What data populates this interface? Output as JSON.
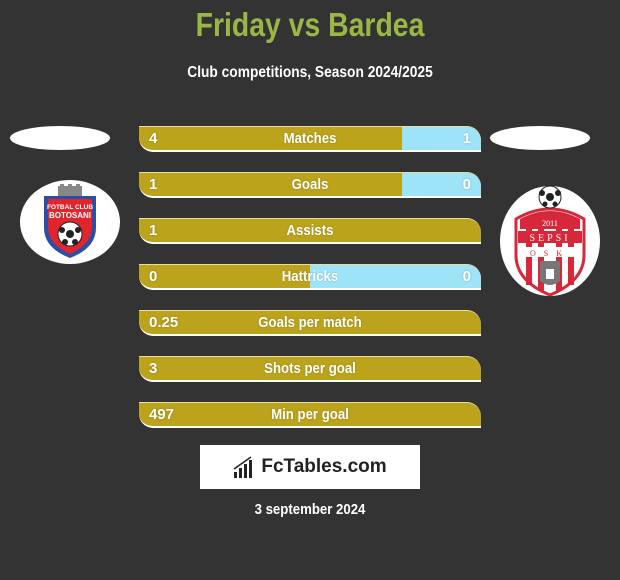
{
  "header": {
    "title": "Friday vs Bardea",
    "subtitle": "Club competitions, Season 2024/2025"
  },
  "teams": {
    "left": {
      "name": "Friday",
      "logo": "FC Botosani crest",
      "logo_text": [
        "FOTBAL CLUB",
        "BOTOSANI"
      ]
    },
    "right": {
      "name": "Bardea",
      "logo": "Sepsi OSK crest",
      "logo_text": [
        "2011",
        "SEPSI",
        "OSK"
      ]
    }
  },
  "colors": {
    "background": "#333333",
    "title": "#99b744",
    "left_bar": "#bba41c",
    "right_bar": "#9ee4f8"
  },
  "stats": [
    {
      "label": "Matches",
      "left": "4",
      "right": "1",
      "right_share": 0.23
    },
    {
      "label": "Goals",
      "left": "1",
      "right": "0",
      "right_share": 0.23
    },
    {
      "label": "Assists",
      "left": "1",
      "right": "",
      "right_share": 0
    },
    {
      "label": "Hattricks",
      "left": "0",
      "right": "0",
      "right_share": 0.5
    },
    {
      "label": "Goals per match",
      "left": "0.25",
      "right": "",
      "right_share": 0
    },
    {
      "label": "Shots per goal",
      "left": "3",
      "right": "",
      "right_share": 0
    },
    {
      "label": "Min per goal",
      "left": "497",
      "right": "",
      "right_share": 0
    }
  ],
  "brand": {
    "icon": "bar-chart-icon",
    "text": "FcTables.com"
  },
  "date": "3 september 2024"
}
